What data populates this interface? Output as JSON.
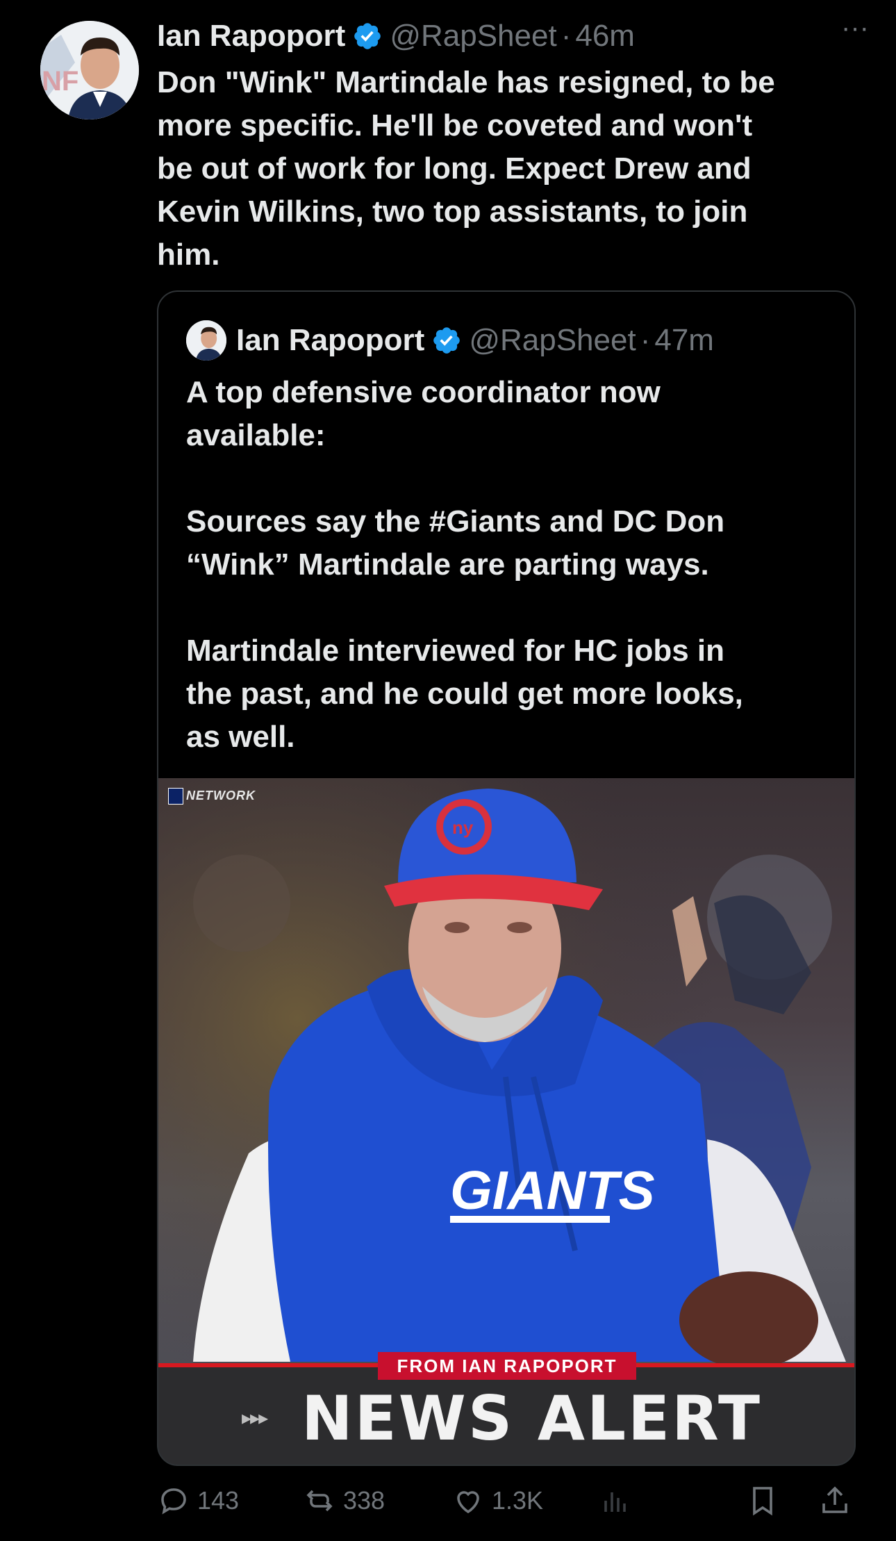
{
  "tweet": {
    "author_name": "Ian Rapoport",
    "handle": "@RapSheet",
    "separator": "·",
    "time": "46m",
    "more_label": "···",
    "text": "Don \"Wink\" Martindale has resigned, to be\nmore specific. He'll be coveted and won't\nbe out of work for long. Expect Drew and\nKevin Wilkins, two top assistants, to join\nhim."
  },
  "quoted": {
    "author_name": "Ian Rapoport",
    "handle": "@RapSheet",
    "separator": "·",
    "time": "47m",
    "text": "A top defensive coordinator now\navailable:\n\nSources say the #Giants and DC Don\n“Wink” Martindale are parting ways.\n\nMartindale interviewed for HC jobs in\nthe past, and he could get more looks,\nas well.",
    "media": {
      "network_logo": "NETWORK",
      "jersey_text": "GIANTS",
      "banner_tag": "FROM IAN RAPOPORT",
      "banner_arrows": "▸▸▸",
      "banner_title": "NEWS ALERT"
    }
  },
  "actions": {
    "replies": "143",
    "reposts": "338",
    "likes": "1.3K"
  },
  "colors": {
    "background": "#000000",
    "text": "#e7e9ea",
    "muted": "#71767b",
    "verified": "#1d9bf0",
    "border": "#2f3336",
    "giants_blue": "#1f4fd1",
    "alert_red": "#c8102e"
  },
  "icons": [
    "verified-badge-icon",
    "more-icon",
    "reply-icon",
    "repost-icon",
    "like-icon",
    "views-icon",
    "bookmark-icon",
    "share-icon"
  ]
}
